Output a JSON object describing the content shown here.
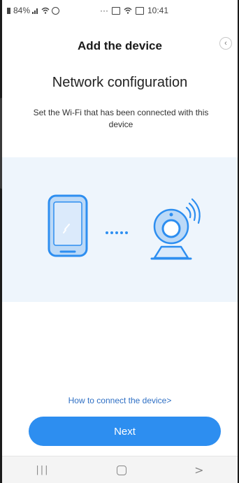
{
  "status_bar": {
    "battery": "84%",
    "time": "10:41",
    "dots": "···"
  },
  "header": {
    "title": "Add the device",
    "back_icon": "chevron-left-icon"
  },
  "content": {
    "heading": "Network configuration",
    "description": "Set the Wi-Fi  that has been connected with this device"
  },
  "illustration": {
    "phone_icon": "phone-icon",
    "camera_icon": "camera-icon",
    "accent_color": "#2d8ef0",
    "background_color": "#eef5fc"
  },
  "footer": {
    "help_link": "How to connect the device>",
    "next_label": "Next",
    "button_color": "#2d8ef0"
  },
  "nav_bar": {
    "recent_glyph": "|||",
    "back_glyph": ">"
  }
}
